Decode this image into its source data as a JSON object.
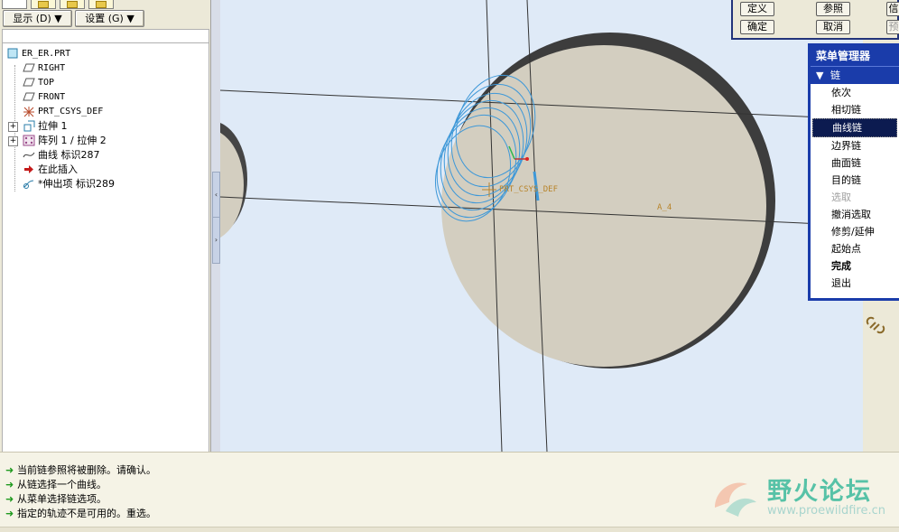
{
  "left_panel": {
    "show_button": "显示 (D) ▼",
    "settings_button": "设置 (G) ▼",
    "tree_items": [
      {
        "label": "ER_ER.PRT",
        "icon": "part-icon"
      },
      {
        "label": "RIGHT",
        "icon": "datum-plane-icon"
      },
      {
        "label": "TOP",
        "icon": "datum-plane-icon"
      },
      {
        "label": "FRONT",
        "icon": "datum-plane-icon"
      },
      {
        "label": "PRT_CSYS_DEF",
        "icon": "csys-icon"
      },
      {
        "label": "拉伸 1",
        "icon": "extrude-icon"
      },
      {
        "label": "阵列 1 / 拉伸 2",
        "icon": "pattern-icon"
      },
      {
        "label": "曲线 标识287",
        "icon": "curve-icon"
      },
      {
        "label": "在此插入",
        "icon": "insert-here-arrow-icon"
      },
      {
        "label": "*伸出项 标识289",
        "icon": "protrusion-icon"
      }
    ]
  },
  "graphics": {
    "csys_label": "PRT_CSYS_DEF",
    "axis_label": "A_4"
  },
  "dashboard": {
    "define": "定义",
    "reference": "参照",
    "info": "信",
    "ok": "确定",
    "cancel": "取消",
    "preview": "预"
  },
  "menu_manager": {
    "title": "菜单管理器",
    "section": "链",
    "items": [
      {
        "label": "依次",
        "state": "normal"
      },
      {
        "label": "相切链",
        "state": "normal"
      },
      {
        "label": "曲线链",
        "state": "selected"
      },
      {
        "label": "边界链",
        "state": "normal"
      },
      {
        "label": "曲面链",
        "state": "normal"
      },
      {
        "label": "目的链",
        "state": "normal"
      },
      {
        "label": "选取",
        "state": "disabled"
      },
      {
        "label": "撤消选取",
        "state": "normal"
      },
      {
        "label": "修剪/延伸",
        "state": "normal"
      },
      {
        "label": "起始点",
        "state": "normal"
      },
      {
        "label": "完成",
        "state": "bold"
      },
      {
        "label": "退出",
        "state": "normal"
      }
    ]
  },
  "messages": [
    "当前链参照将被删除。请确认。",
    "从链选择一个曲线。",
    "从菜单选择链选项。",
    "指定的轨迹不是可用的。重选。"
  ],
  "watermark": {
    "title": "野火论坛",
    "url": "www.proewildfire.cn"
  },
  "colors": {
    "graphics_bg": "#dfeaf7",
    "solid_fill": "#d3cec0",
    "solid_edge": "#454545",
    "curve": "#3e98d8",
    "menu_header": "#1a3caa",
    "message_arrow": "#1f9a1f"
  }
}
